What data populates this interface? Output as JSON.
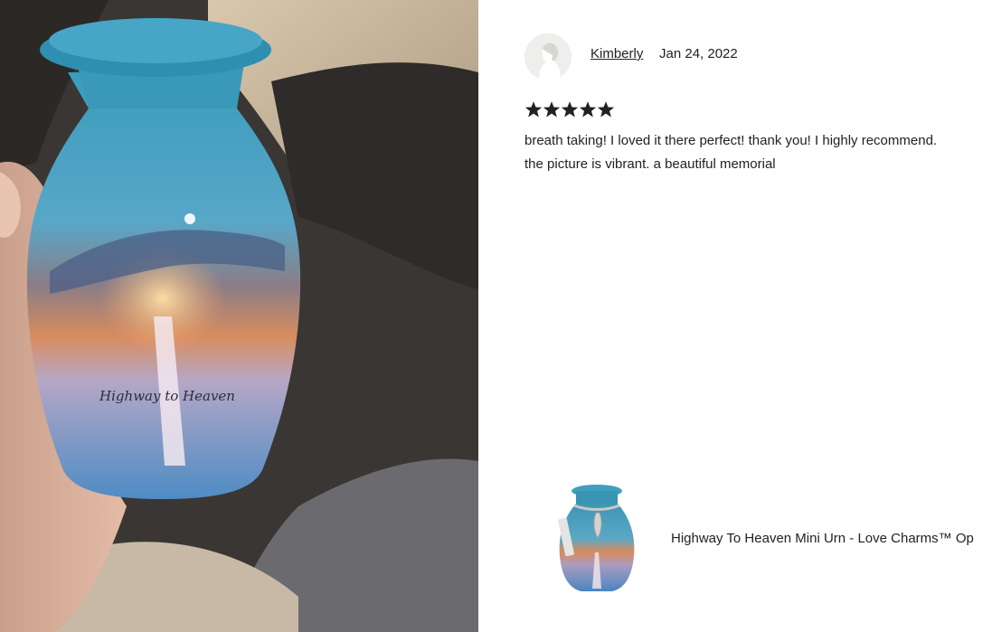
{
  "review": {
    "reviewer_name": "Kimberly",
    "date": "Jan 24, 2022",
    "rating": 5,
    "text_line_1": "breath taking! I loved it there perfect! thank you! I highly recommend.",
    "text_line_2": "the picture is vibrant. a beautiful memorial"
  },
  "photo": {
    "urn_inscription": "Highway to Heaven"
  },
  "product": {
    "title": "Highway To Heaven Mini Urn - Love Charms™ Op"
  },
  "colors": {
    "text": "#222222",
    "star": "#222222",
    "urn_teal": "#3d96b4",
    "avatar_bg": "#eeeeec"
  }
}
